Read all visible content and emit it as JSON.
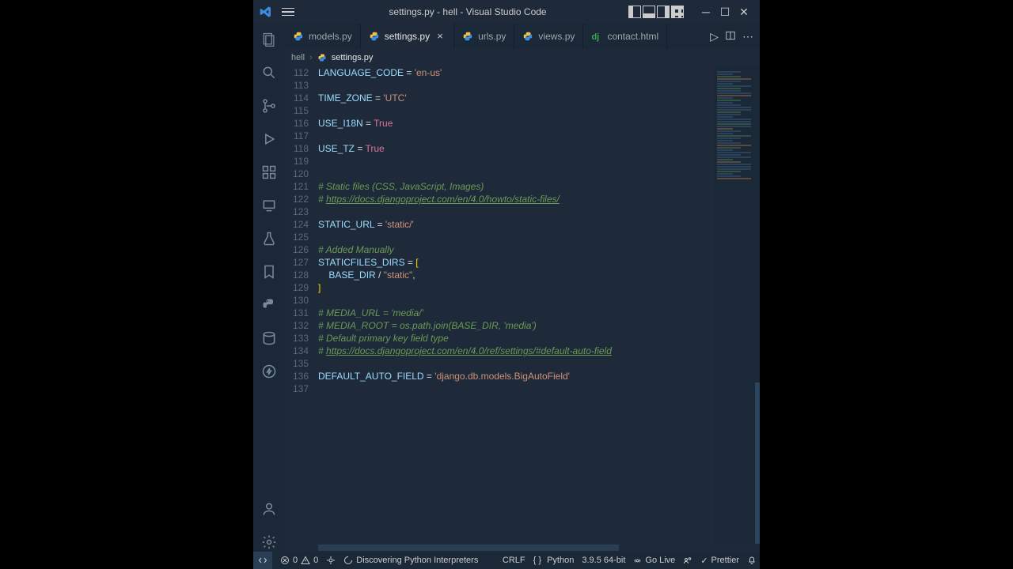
{
  "title": "settings.py - hell - Visual Studio Code",
  "tabs": [
    {
      "icon": "py",
      "label": "models.py",
      "active": false
    },
    {
      "icon": "py",
      "label": "settings.py",
      "active": true,
      "close": true
    },
    {
      "icon": "py",
      "label": "urls.py",
      "active": false
    },
    {
      "icon": "py",
      "label": "views.py",
      "active": false
    },
    {
      "icon": "dj",
      "label": "contact.html",
      "active": false
    }
  ],
  "breadcrumb": {
    "root": "hell",
    "file": "settings.py"
  },
  "lines": [
    {
      "n": 112,
      "t": "var",
      "v1": "LANGUAGE_CODE",
      "op": " = ",
      "v2": "'en-us'"
    },
    {
      "n": 113,
      "t": "blank"
    },
    {
      "n": 114,
      "t": "var",
      "v1": "TIME_ZONE",
      "op": " = ",
      "v2": "'UTC'"
    },
    {
      "n": 115,
      "t": "blank"
    },
    {
      "n": 116,
      "t": "bool",
      "v1": "USE_I18N",
      "op": " = ",
      "v2": "True"
    },
    {
      "n": 117,
      "t": "blank"
    },
    {
      "n": 118,
      "t": "bool",
      "v1": "USE_TZ",
      "op": " = ",
      "v2": "True"
    },
    {
      "n": 119,
      "t": "blank"
    },
    {
      "n": 120,
      "t": "blank"
    },
    {
      "n": 121,
      "t": "cmt",
      "c": "# Static files (CSS, JavaScript, Images)"
    },
    {
      "n": 122,
      "t": "cmtlink",
      "p": "# ",
      "l": "https://docs.djangoproject.com/en/4.0/howto/static-files/"
    },
    {
      "n": 123,
      "t": "blank"
    },
    {
      "n": 124,
      "t": "var",
      "v1": "STATIC_URL",
      "op": " = ",
      "v2": "'static/'"
    },
    {
      "n": 125,
      "t": "blank"
    },
    {
      "n": 126,
      "t": "cmt",
      "c": "# Added Manually"
    },
    {
      "n": 127,
      "t": "open",
      "v1": "STATICFILES_DIRS",
      "op": " = ",
      "b": "["
    },
    {
      "n": 128,
      "t": "item",
      "ind": "    ",
      "v1": "BASE_DIR",
      "op": " / ",
      "v2": "\"static\"",
      "tr": ","
    },
    {
      "n": 129,
      "t": "close",
      "b": "]"
    },
    {
      "n": 130,
      "t": "blank"
    },
    {
      "n": 131,
      "t": "cmt",
      "c": "# MEDIA_URL = 'media/'"
    },
    {
      "n": 132,
      "t": "cmt",
      "c": "# MEDIA_ROOT = os.path.join(BASE_DIR, 'media')"
    },
    {
      "n": 133,
      "t": "cmt",
      "c": "# Default primary key field type"
    },
    {
      "n": 134,
      "t": "cmtlink",
      "p": "# ",
      "l": "https://docs.djangoproject.com/en/4.0/ref/settings/#default-auto-field"
    },
    {
      "n": 135,
      "t": "blank"
    },
    {
      "n": 136,
      "t": "var",
      "v1": "DEFAULT_AUTO_FIELD",
      "op": " = ",
      "v2": "'django.db.models.BigAutoField'"
    },
    {
      "n": 137,
      "t": "blank"
    }
  ],
  "status": {
    "errors": "0",
    "warnings": "0",
    "discover": "Discovering Python Interpreters",
    "eol": "CRLF",
    "lang": "Python",
    "ver": "3.9.5 64-bit",
    "golive": "Go Live",
    "prettier": "Prettier"
  }
}
